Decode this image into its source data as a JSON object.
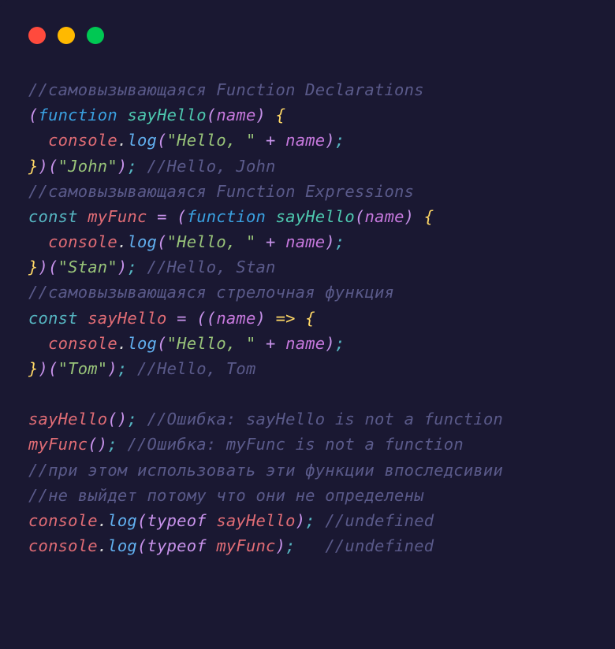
{
  "titlebar": {
    "dots": [
      "red",
      "yellow",
      "green"
    ]
  },
  "code": {
    "l1_comment": "//самовызывающаяся Function Declarations",
    "l2": {
      "open": "(",
      "kw": "function",
      "name": "sayHello",
      "popen": "(",
      "param": "name",
      "pclose": ")",
      "brace": "{"
    },
    "l3": {
      "indent": "  ",
      "obj": "console",
      "dot": ".",
      "method": "log",
      "popen": "(",
      "str": "\"Hello, \"",
      "plus": " + ",
      "param": "name",
      "pclose": ")",
      "semi": ";"
    },
    "l4": {
      "brace": "}",
      "close": ")(",
      "str": "\"John\"",
      "close2": ")",
      "semi": ";",
      "cmt": " //Hello, John"
    },
    "l5_comment": "//самовызывающаяся Function Expressions",
    "l6": {
      "kw": "const",
      "var": "myFunc",
      "eq": " = ",
      "open": "(",
      "fkw": "function",
      "name": "sayHello",
      "popen": "(",
      "param": "name",
      "pclose": ")",
      "brace": "{"
    },
    "l7": {
      "indent": "  ",
      "obj": "console",
      "dot": ".",
      "method": "log",
      "popen": "(",
      "str": "\"Hello, \"",
      "plus": " + ",
      "param": "name",
      "pclose": ")",
      "semi": ";"
    },
    "l8": {
      "brace": "}",
      "close": ")(",
      "str": "\"Stan\"",
      "close2": ")",
      "semi": ";",
      "cmt": " //Hello, Stan"
    },
    "l9_comment": "//самовызывающаяся стрелочная функция",
    "l10": {
      "kw": "const",
      "var": "sayHello",
      "eq": " = ",
      "open": "((",
      "param": "name",
      "close": ")",
      "arrow": " => ",
      "brace": "{"
    },
    "l11": {
      "indent": "  ",
      "obj": "console",
      "dot": ".",
      "method": "log",
      "popen": "(",
      "str": "\"Hello, \"",
      "plus": " + ",
      "param": "name",
      "pclose": ")",
      "semi": ";"
    },
    "l12": {
      "brace": "}",
      "close": ")(",
      "str": "\"Tom\"",
      "close2": ")",
      "semi": ";",
      "cmt": " //Hello, Tom"
    },
    "l13_blank": "",
    "l14": {
      "call": "sayHello",
      "popen": "()",
      "semi": ";",
      "cmt": " //Ошибка: sayHello is not a function"
    },
    "l15": {
      "call": "myFunc",
      "popen": "()",
      "semi": ";",
      "cmt": " //Ошибка: myFunc is not a function"
    },
    "l16_comment": "//при этом использовать эти функции впоследсивии",
    "l17_comment": "//не выйдет потому что они не определены",
    "l18": {
      "obj": "console",
      "dot": ".",
      "method": "log",
      "popen": "(",
      "typeof": "typeof",
      "sp": " ",
      "var": "sayHello",
      "pclose": ")",
      "semi": ";",
      "cmt": " //undefined"
    },
    "l19": {
      "obj": "console",
      "dot": ".",
      "method": "log",
      "popen": "(",
      "typeof": "typeof",
      "sp": " ",
      "var": "myFunc",
      "pclose": ")",
      "semi": ";",
      "pad": "   ",
      "cmt": "//undefined"
    }
  }
}
